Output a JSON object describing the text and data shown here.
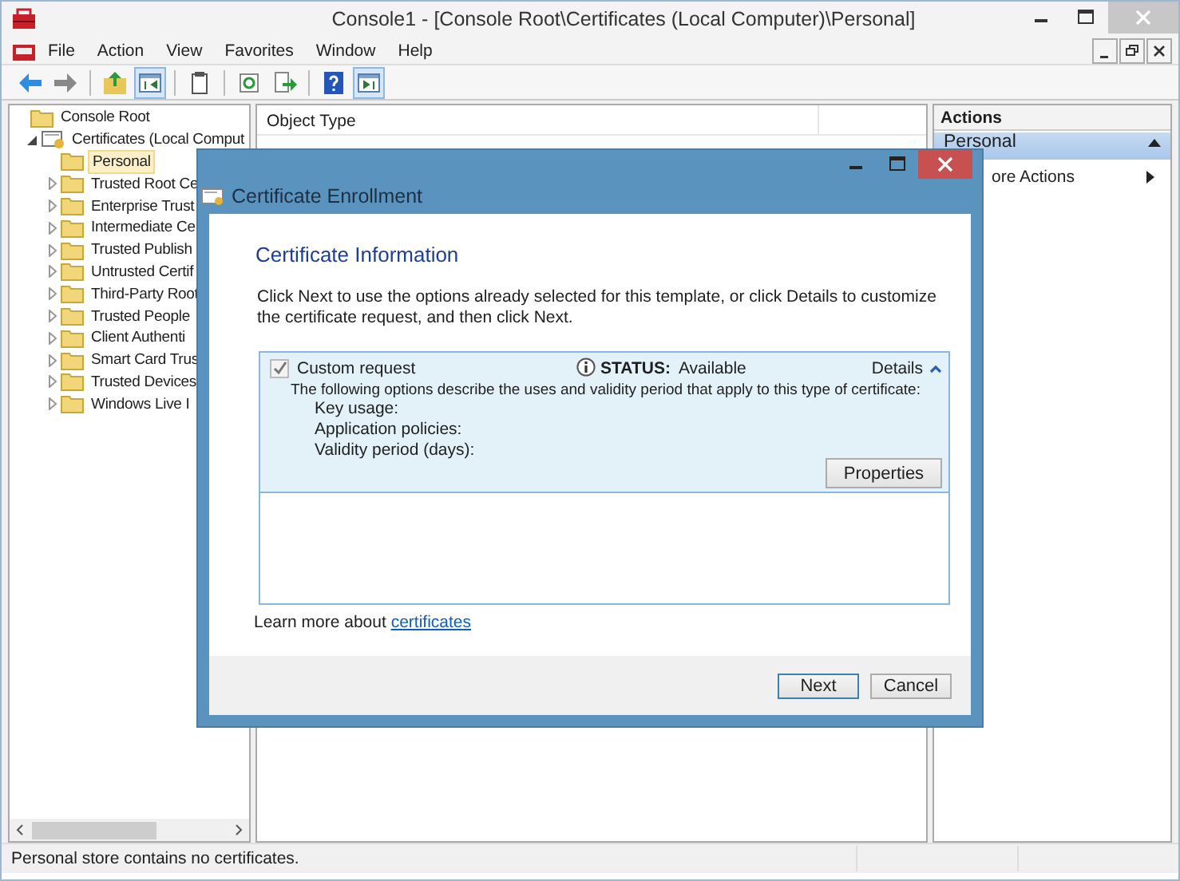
{
  "window": {
    "title": "Console1 - [Console Root\\Certificates (Local Computer)\\Personal]"
  },
  "menu": [
    "File",
    "Action",
    "View",
    "Favorites",
    "Window",
    "Help"
  ],
  "toolbar": [
    [
      {
        "kind": "back",
        "pressed": false
      },
      {
        "kind": "forward",
        "pressed": false
      }
    ],
    [
      {
        "kind": "up",
        "pressed": false
      },
      {
        "kind": "tree",
        "pressed": true
      }
    ],
    [
      {
        "kind": "properties",
        "pressed": false
      }
    ],
    [
      {
        "kind": "refresh",
        "pressed": false
      },
      {
        "kind": "export",
        "pressed": false
      }
    ],
    [
      {
        "kind": "help",
        "pressed": false
      },
      {
        "kind": "actionpane",
        "pressed": true
      }
    ]
  ],
  "tree": [
    {
      "label": "Console Root",
      "kind": "folder",
      "selected": false,
      "children": [
        {
          "label": "Certificates (Local Comput",
          "kind": "store",
          "expanded": true,
          "selected": false,
          "children": [
            {
              "label": "Personal",
              "kind": "folder",
              "selected": true
            },
            {
              "label": "Trusted Root Ce",
              "kind": "folder",
              "expanded": false,
              "selected": false
            },
            {
              "label": "Enterprise Trust",
              "kind": "folder",
              "expanded": false,
              "selected": false
            },
            {
              "label": "Intermediate Ce",
              "kind": "folder",
              "expanded": false,
              "selected": false
            },
            {
              "label": "Trusted Publish",
              "kind": "folder",
              "expanded": false,
              "selected": false
            },
            {
              "label": "Untrusted Certif",
              "kind": "folder",
              "expanded": false,
              "selected": false
            },
            {
              "label": "Third-Party Root",
              "kind": "folder",
              "expanded": false,
              "selected": false
            },
            {
              "label": "Trusted People",
              "kind": "folder",
              "expanded": false,
              "selected": false
            },
            {
              "label": "Client Authenti",
              "kind": "folder",
              "expanded": false,
              "selected": false
            },
            {
              "label": "Smart Card Trus",
              "kind": "folder",
              "expanded": false,
              "selected": false
            },
            {
              "label": "Trusted Devices",
              "kind": "folder",
              "expanded": false,
              "selected": false
            },
            {
              "label": "Windows Live I",
              "kind": "folder",
              "expanded": false,
              "selected": false
            }
          ]
        }
      ]
    }
  ],
  "list": {
    "columns": [
      "Object Type"
    ]
  },
  "actions": {
    "title": "Actions",
    "section": {
      "label": "Personal",
      "expanded": true
    },
    "items": [
      "ore Actions"
    ]
  },
  "status_bar": "Personal store contains no certificates.",
  "dialog": {
    "title": "Certificate Enrollment",
    "heading": "Certificate Information",
    "intro": "Click Next to use the options already selected for this template, or click Details to customize the certificate request, and then click Next.",
    "request": {
      "label": "Custom request",
      "checked": true,
      "status_label": "STATUS:",
      "status": "Available",
      "details": "Details",
      "expanded": true,
      "description": "The following options describe the uses and validity period that apply to this type of certificate:",
      "fields": [
        "Key usage:",
        "Application policies:",
        "Validity period (days):"
      ],
      "button": "Properties"
    },
    "learn_more": "Learn more about",
    "link": "certificates",
    "buttons": [
      {
        "label": "Next",
        "default": true
      },
      {
        "label": "Cancel",
        "default": false
      }
    ]
  }
}
